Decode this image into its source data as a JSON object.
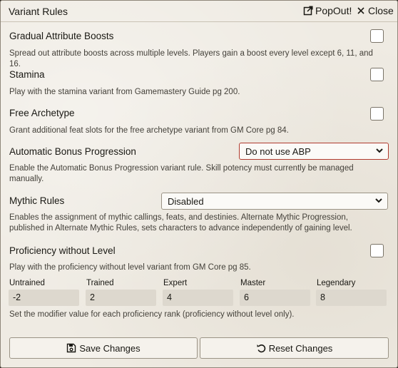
{
  "window": {
    "title": "Variant Rules",
    "popout_label": "PopOut!",
    "close_label": "Close"
  },
  "settings": {
    "gradual": {
      "label": "Gradual Attribute Boosts",
      "hint": "Spread out attribute boosts across multiple levels. Players gain a boost every level except 6, 11, and 16.",
      "checked": false
    },
    "stamina": {
      "label": "Stamina",
      "hint": "Play with the stamina variant from Gamemastery Guide pg 200.",
      "checked": false
    },
    "free_archetype": {
      "label": "Free Archetype",
      "hint": "Grant additional feat slots for the free archetype variant from GM Core pg 84.",
      "checked": false
    },
    "abp": {
      "label": "Automatic Bonus Progression",
      "selected": "Do not use ABP",
      "hint": "Enable the Automatic Bonus Progression variant rule. Skill potency must currently be managed manually."
    },
    "mythic": {
      "label": "Mythic Rules",
      "selected": "Disabled",
      "hint": "Enables the assignment of mythic callings, feats, and destinies. Alternate Mythic Progression, published in Alternate Mythic Rules, sets characters to advance independently of gaining level."
    },
    "pwol": {
      "label": "Proficiency without Level",
      "hint": "Play with the proficiency without level variant from GM Core pg 85.",
      "checked": false,
      "ranks": [
        {
          "label": "Untrained",
          "value": "-2"
        },
        {
          "label": "Trained",
          "value": "2"
        },
        {
          "label": "Expert",
          "value": "4"
        },
        {
          "label": "Master",
          "value": "6"
        },
        {
          "label": "Legendary",
          "value": "8"
        }
      ],
      "ranks_hint": "Set the modifier value for each proficiency rank (proficiency without level only)."
    }
  },
  "footer": {
    "save_label": "Save Changes",
    "reset_label": "Reset Changes"
  },
  "icons": {
    "popout": "external-link-icon",
    "save": "floppy-disk-icon",
    "reset": "undo-icon"
  }
}
